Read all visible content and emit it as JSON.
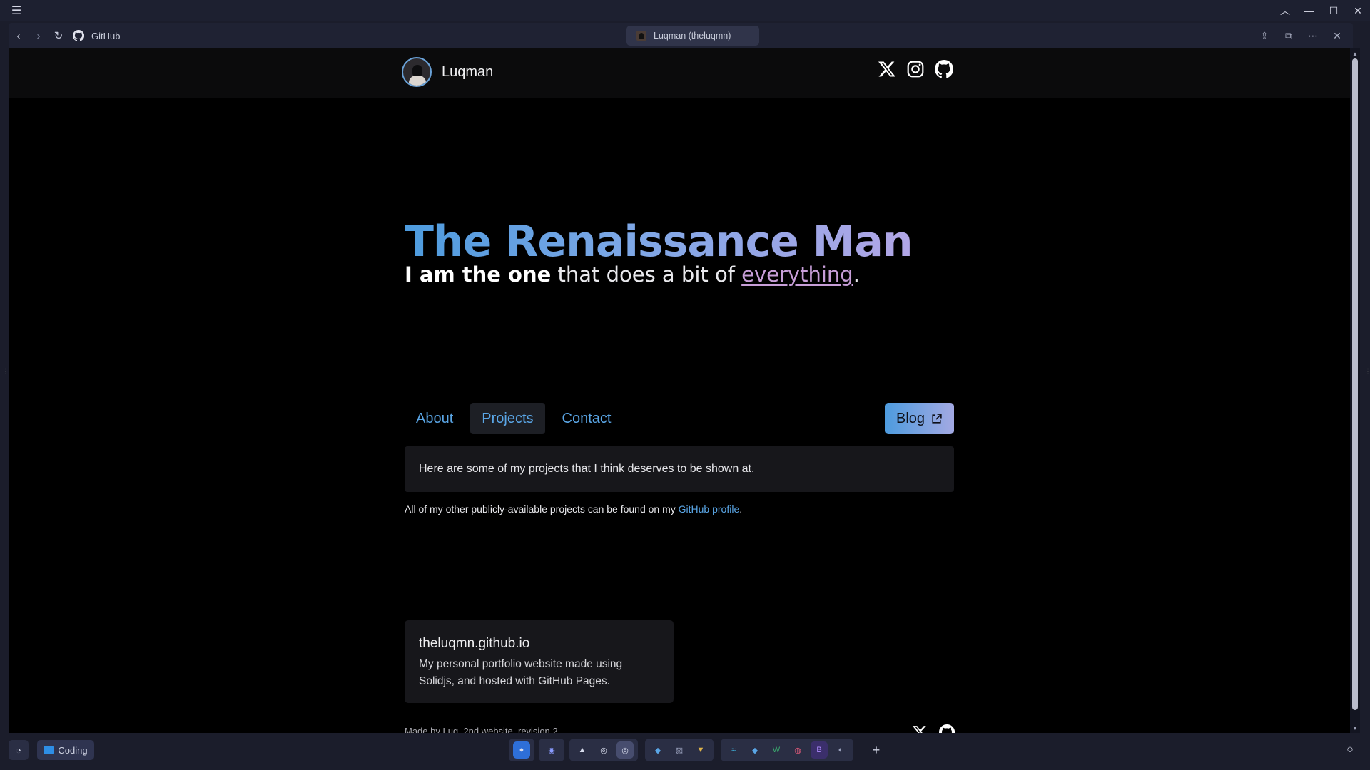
{
  "browser": {
    "site_label": "GitHub",
    "tab_title": "Luqman (theluqmn)"
  },
  "site": {
    "brand_name": "Luqman",
    "hero_title": "The Renaissance Man",
    "hero_sub_bold": "I am the one",
    "hero_sub_mid": " that does a bit of ",
    "hero_sub_link": "everything",
    "hero_sub_end": ".",
    "tabs": [
      "About",
      "Projects",
      "Contact"
    ],
    "selected_tab": "Projects",
    "blog_label": "Blog",
    "panel_text": "Here are some of my projects that I think deserves to be shown at.",
    "note_prefix": "All of my other publicly-available projects can be found on my ",
    "note_link": "GitHub profile",
    "note_suffix": ".",
    "project": {
      "title": "theluqmn.github.io",
      "description": "My personal portfolio website made using Solidjs, and hosted with GitHub Pages."
    },
    "footer_text": "Made by Luq. 2nd website, revision 2"
  },
  "taskbar": {
    "workspace_label": "Coding",
    "add_label": "+"
  },
  "colors": {
    "accent_blue": "#5aa6e6",
    "gradient_start": "#4d9bde",
    "gradient_end": "#b2a6e6",
    "link_purple": "#c79ed8"
  }
}
